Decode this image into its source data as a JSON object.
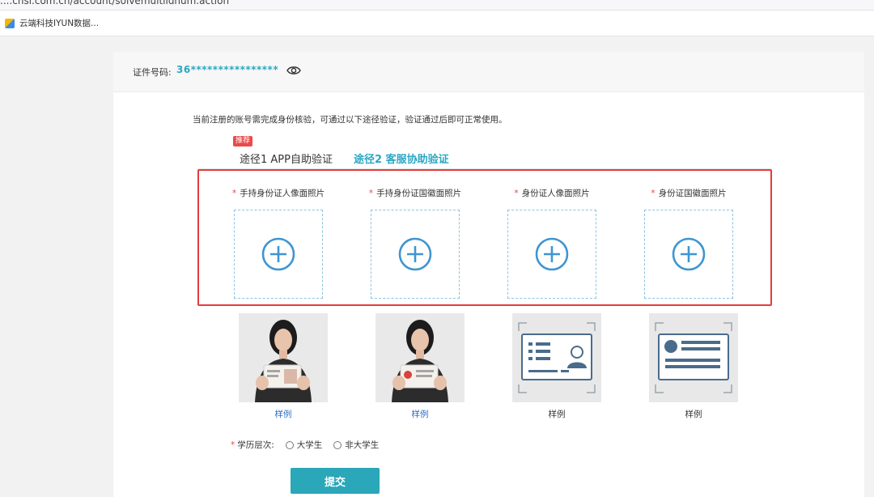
{
  "browser": {
    "url": "....chsi.com.cn/account/solvemultiidnum.action",
    "bookmark": "云端科技IYUN数据..."
  },
  "identity": {
    "label": "证件号码:",
    "value": "36****************"
  },
  "notice": "当前注册的账号需完成身份核验，可通过以下途径验证，验证通过后即可正常使用。",
  "tabs": [
    {
      "label": "途径1 APP自助验证",
      "badge": "推荐"
    },
    {
      "label": "途径2 客服协助验证"
    }
  ],
  "uploads": [
    {
      "required": "*",
      "label": "手持身份证人像面照片",
      "caption": "样例"
    },
    {
      "required": "*",
      "label": "手持身份证国徽面照片",
      "caption": "样例"
    },
    {
      "required": "*",
      "label": "身份证人像面照片",
      "caption": "样例"
    },
    {
      "required": "*",
      "label": "身份证国徽面照片",
      "caption": "样例"
    }
  ],
  "education": {
    "required": "*",
    "label": "学历层次:",
    "options": [
      "大学生",
      "非大学生"
    ]
  },
  "submit_label": "提交",
  "colors": {
    "accent": "#2aa7c4",
    "button": "#2aa7b8",
    "highlight_frame": "#e53b3b",
    "required": "#e34b4b"
  }
}
